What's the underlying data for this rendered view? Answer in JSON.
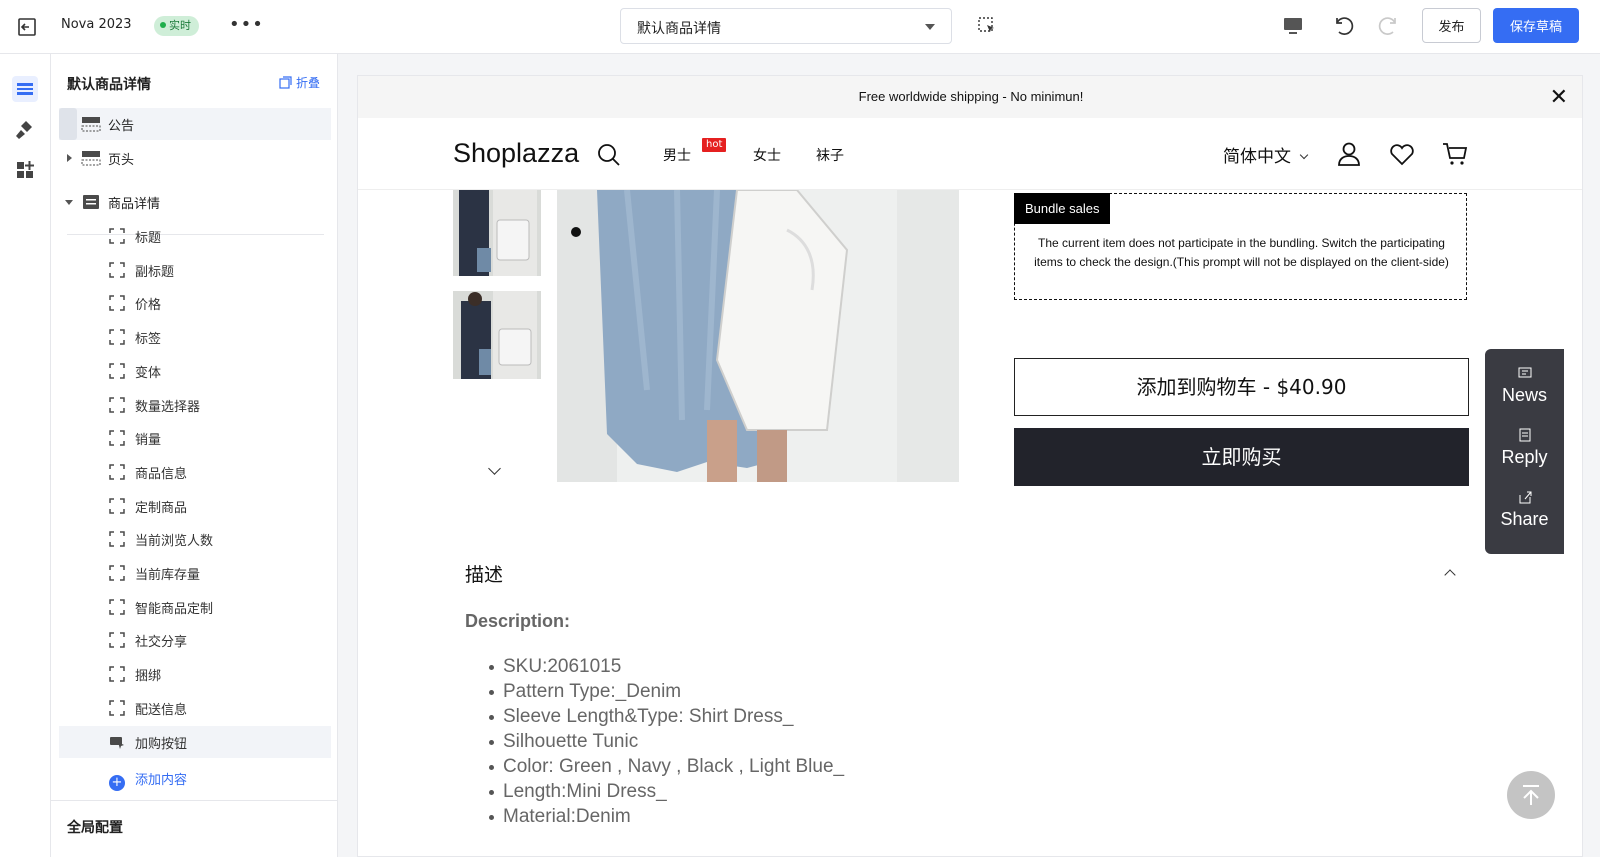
{
  "topbar": {
    "store_name": "Nova 2023",
    "live_label": "实时",
    "more_label": "•••",
    "template_select": "默认商品详情",
    "publish_label": "发布",
    "save_label": "保存草稿"
  },
  "panel": {
    "title": "默认商品详情",
    "collapse_label": "折叠",
    "sections": [
      {
        "label": "公告"
      },
      {
        "label": "页头"
      },
      {
        "label": "商品详情"
      }
    ],
    "blocks": [
      "标题",
      "副标题",
      "价格",
      "标签",
      "变体",
      "数量选择器",
      "销量",
      "商品信息",
      "定制商品",
      "当前浏览人数",
      "当前库存量",
      "智能商品定制",
      "社交分享",
      "捆绑",
      "配送信息",
      "加购按钮"
    ],
    "add_content_label": "添加内容",
    "global_label": "全局配置"
  },
  "preview": {
    "announcement": "Free worldwide shipping - No minimun!",
    "close_symbol": "✕",
    "logo": "Shoplazza",
    "nav": [
      {
        "label": "男士",
        "badge": "hot"
      },
      {
        "label": "女士"
      },
      {
        "label": "袜子"
      }
    ],
    "language": "简体中文",
    "bundle": {
      "tag": "Bundle sales",
      "message": "The current item does not participate in the bundling. Switch the participating items to check the design.(This prompt will not be displayed on the client-side)"
    },
    "add_to_cart": "添加到购物车 - $40.90",
    "buy_now": "立即购买",
    "description_title": "描述",
    "description_subtitle": "Description:",
    "description_items": [
      "SKU:2061015",
      "Pattern Type:_Denim",
      "Sleeve Length&Type: Shirt Dress_",
      "Silhouette Tunic",
      "Color: Green , Navy , Black , Light Blue_",
      "Length:Mini Dress_",
      "Material:Denim"
    ],
    "social": [
      "News",
      "Reply",
      "Share"
    ]
  },
  "colors": {
    "accent": "#356df3",
    "live_bg": "#cfeed8",
    "buy_button": "#22232b",
    "hot_badge": "#e52020",
    "social_bg": "#3a3b42"
  },
  "icons": {
    "rail": [
      "sections-icon",
      "theme-style-icon",
      "apps-icon"
    ]
  }
}
